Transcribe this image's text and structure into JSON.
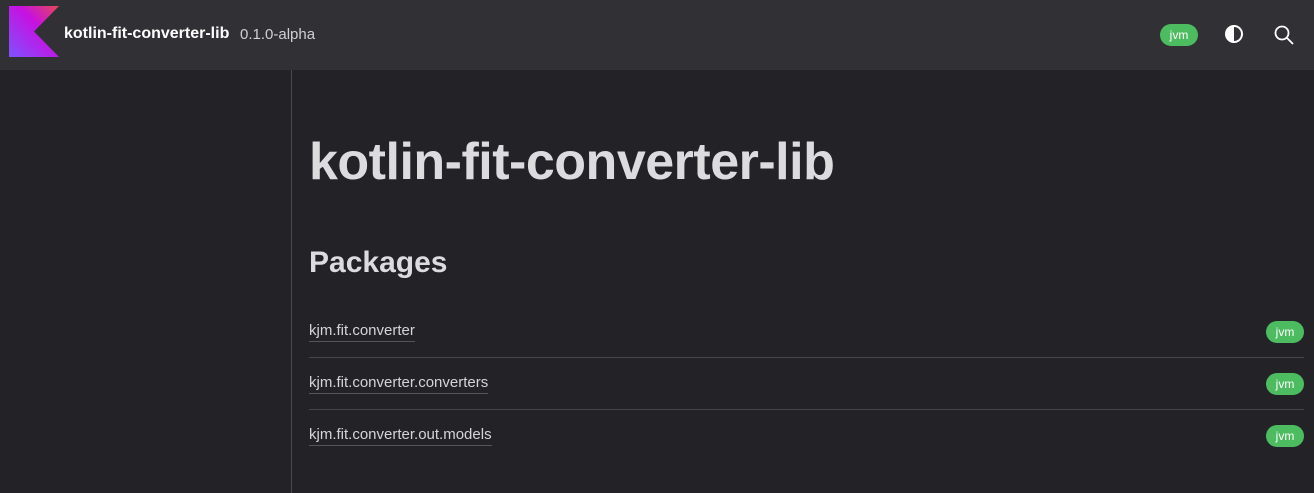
{
  "header": {
    "library_name": "kotlin-fit-converter-lib",
    "version": "0.1.0-alpha",
    "platform_badge": "jvm",
    "icons": [
      "kotlin-logo",
      "theme-toggle-icon",
      "search-icon"
    ]
  },
  "main": {
    "title": "kotlin-fit-converter-lib",
    "packages_heading": "Packages",
    "packages": [
      {
        "name": "kjm.fit.converter",
        "platform": "jvm"
      },
      {
        "name": "kjm.fit.converter.converters",
        "platform": "jvm"
      },
      {
        "name": "kjm.fit.converter.out.models",
        "platform": "jvm"
      }
    ]
  },
  "colors": {
    "badge": "#4dbb5f",
    "header_bg": "#313135",
    "page_bg": "#232327"
  }
}
